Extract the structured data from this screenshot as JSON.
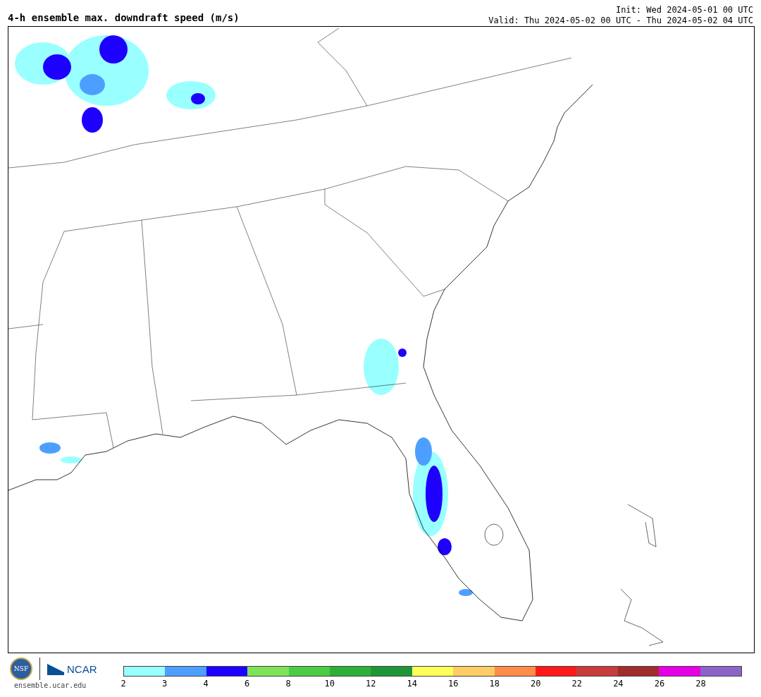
{
  "title": "4-h ensemble max. downdraft speed (m/s)",
  "init": "Init: Wed 2024-05-01 00 UTC",
  "valid": "Valid: Thu 2024-05-02 00 UTC - Thu 2024-05-02 04 UTC",
  "logos": {
    "nsf": "NSF",
    "ncar": "NCAR"
  },
  "site": "ensemble.ucar.edu",
  "colorbar": [
    {
      "label": "2",
      "color": "#99ffff"
    },
    {
      "label": "3",
      "color": "#4d9fff"
    },
    {
      "label": "4",
      "color": "#1e00ff"
    },
    {
      "label": "6",
      "color": "#7ee35a"
    },
    {
      "label": "8",
      "color": "#4ccc44"
    },
    {
      "label": "10",
      "color": "#2eb038"
    },
    {
      "label": "12",
      "color": "#1e9638"
    },
    {
      "label": "14",
      "color": "#ffff5c"
    },
    {
      "label": "16",
      "color": "#ffcc66"
    },
    {
      "label": "18",
      "color": "#ff8c4a"
    },
    {
      "label": "20",
      "color": "#ff1a1a"
    },
    {
      "label": "22",
      "color": "#c83c3c"
    },
    {
      "label": "24",
      "color": "#a02c2c"
    },
    {
      "label": "26",
      "color": "#e600e6"
    },
    {
      "label": "28",
      "color": "#8c64c8"
    }
  ]
}
